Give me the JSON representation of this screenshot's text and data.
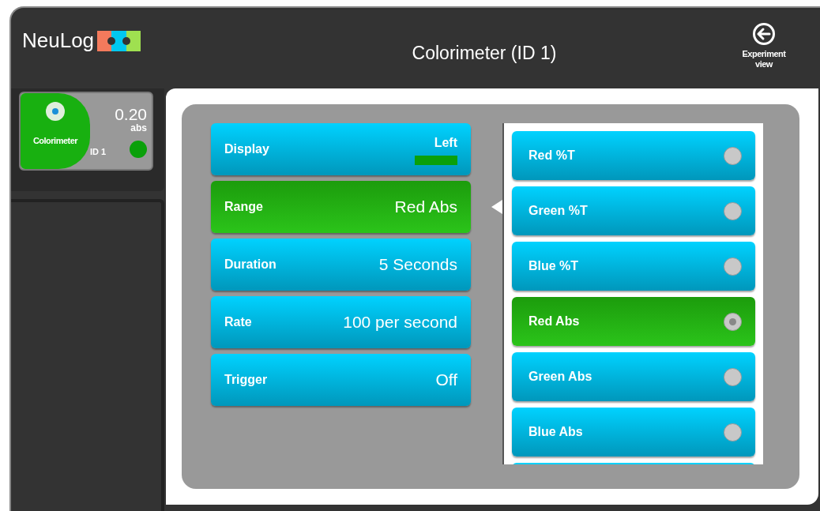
{
  "header": {
    "logo": "NeuLog",
    "title": "Colorimeter (ID 1)",
    "nav_button": "Experiment view"
  },
  "sensor": {
    "name": "Colorimeter",
    "value": "0.20",
    "unit": "abs",
    "id": "ID 1"
  },
  "settings": [
    {
      "label": "Display",
      "value": "Left",
      "kind": "color",
      "color": "#0aa00a",
      "selected": false
    },
    {
      "label": "Range",
      "value": "Red Abs",
      "kind": "value",
      "selected": true
    },
    {
      "label": "Duration",
      "value": "5 Seconds",
      "kind": "value",
      "selected": false
    },
    {
      "label": "Rate",
      "value": "100 per second",
      "kind": "value",
      "selected": false
    },
    {
      "label": "Trigger",
      "value": "Off",
      "kind": "value",
      "selected": false
    }
  ],
  "options": [
    {
      "label": "Red %T",
      "selected": false
    },
    {
      "label": "Green %T",
      "selected": false
    },
    {
      "label": "Blue %T",
      "selected": false
    },
    {
      "label": "Red Abs",
      "selected": true
    },
    {
      "label": "Green Abs",
      "selected": false
    },
    {
      "label": "Blue Abs",
      "selected": false
    }
  ]
}
